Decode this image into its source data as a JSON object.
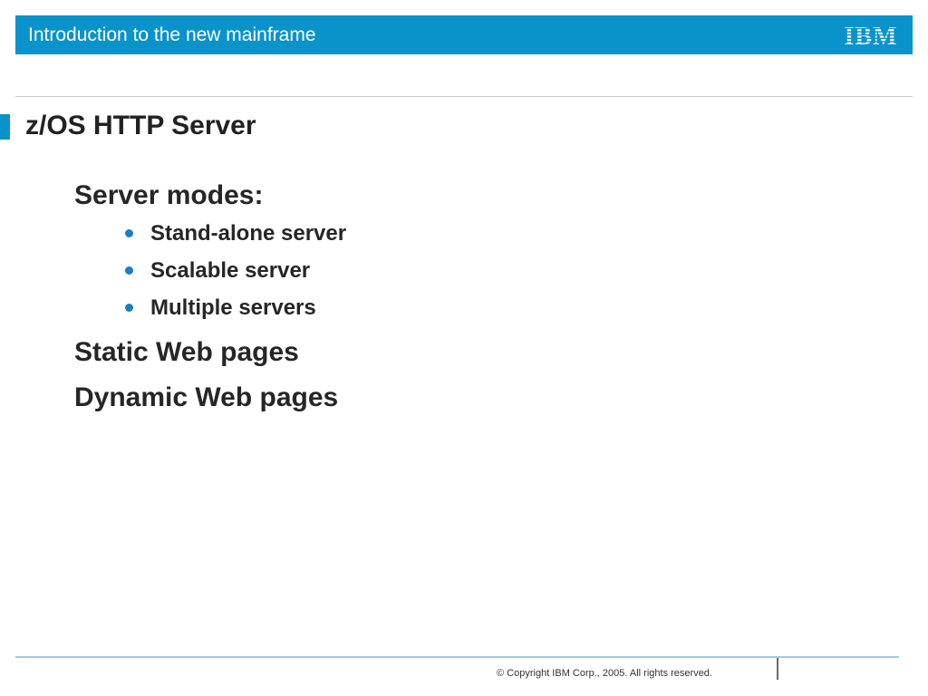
{
  "header": {
    "title": "Introduction to the new mainframe",
    "logo_text": "IBM",
    "color": "#0a93cb"
  },
  "slide": {
    "title": "z/OS HTTP Server",
    "content": {
      "server_modes_heading": "Server modes:",
      "server_modes": [
        "Stand-alone server",
        "Scalable server",
        "Multiple servers"
      ],
      "static_pages": "Static Web pages",
      "dynamic_pages": "Dynamic Web pages"
    }
  },
  "footer": {
    "copyright": "© Copyright IBM Corp., 2005. All rights reserved."
  }
}
